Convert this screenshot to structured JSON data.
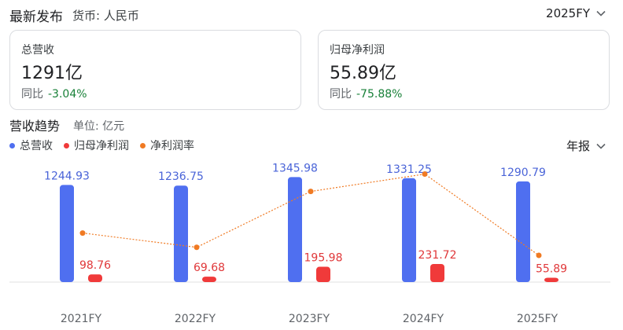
{
  "header": {
    "title": "最新发布",
    "currency": "货币: 人民币",
    "period": "2025FY"
  },
  "cards": [
    {
      "label": "总营收",
      "value": "1291亿",
      "yoy_label": "同比",
      "yoy_change": "-3.04%"
    },
    {
      "label": "归母净利润",
      "value": "55.89亿",
      "yoy_label": "同比",
      "yoy_change": "-75.88%"
    }
  ],
  "section": {
    "title": "营收趋势",
    "unit": "单位: 亿元",
    "report_selector": "年报"
  },
  "colors": {
    "revenue": "#4f6ff0",
    "profit": "#f03a3a",
    "margin": "#f07a23",
    "revenue_label": "#4a64d8",
    "profit_label": "#e0383a",
    "positive_green": "#188038"
  },
  "chart_data": {
    "type": "bar",
    "categories": [
      "2021FY",
      "2022FY",
      "2023FY",
      "2024FY",
      "2025FY"
    ],
    "series": [
      {
        "name": "总营收",
        "type": "bar",
        "values": [
          1244.93,
          1236.75,
          1345.98,
          1331.25,
          1290.79
        ]
      },
      {
        "name": "归母净利润",
        "type": "bar",
        "values": [
          98.76,
          69.68,
          195.98,
          231.72,
          55.89
        ]
      },
      {
        "name": "净利润率",
        "type": "line",
        "values": [
          7.9,
          5.6,
          14.6,
          17.4,
          4.3
        ]
      }
    ],
    "legend_position": "top-left",
    "grid": false
  }
}
